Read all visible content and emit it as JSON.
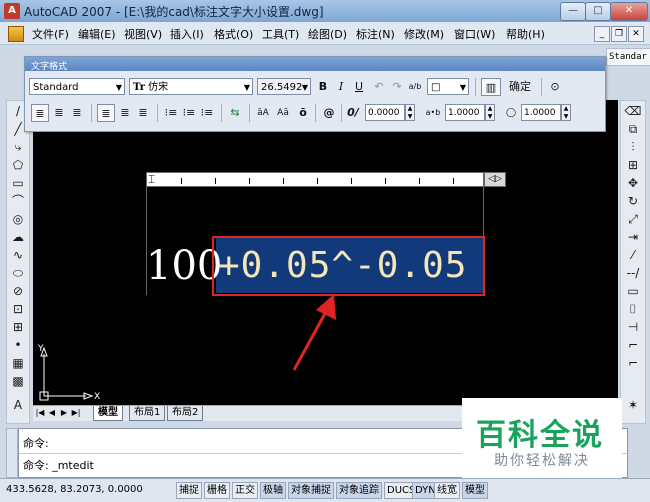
{
  "window": {
    "title": "AutoCAD 2007 - [E:\\我的cad\\标注文字大小设置.dwg]",
    "app_icon_glyph": "A",
    "min_glyph": "—",
    "max_glyph": "□",
    "close_glyph": "✕"
  },
  "menubar": {
    "items": [
      "文件(F)",
      "编辑(E)",
      "视图(V)",
      "插入(I)",
      "格式(O)",
      "工具(T)",
      "绘图(D)",
      "标注(N)",
      "修改(M)",
      "窗口(W)",
      "帮助(H)"
    ],
    "mdi_min": "_",
    "mdi_restore": "❐",
    "mdi_close": "✕"
  },
  "standard_tab": "Standar",
  "text_formatting": {
    "title": "文字格式",
    "style": "Standard",
    "font": "仿宋",
    "font_prefix": "Tr",
    "height": "26.5492",
    "bold": "B",
    "italic": "I",
    "underline": "U",
    "undo": "↶",
    "redo": "↷",
    "stack": "a/b",
    "color_box": "□",
    "ruler_toggle": "▥",
    "ok": "确定",
    "options": "⊙",
    "oblique_label": "0/",
    "oblique_value": "0.0000",
    "tracking_label": "a•b",
    "tracking_value": "1.0000",
    "width_label": "◯",
    "width_value": "1.0000",
    "row2_icons": [
      "≣",
      "≣",
      "≣",
      "≣",
      "≣",
      "≣",
      "⁝≡",
      "⁝≡",
      "⁝≡",
      "⇆",
      "āA",
      "Aā",
      "ō",
      "@"
    ]
  },
  "mtext": {
    "base": "100",
    "stacked": "+0.05^-0.05"
  },
  "ruler": {
    "indent_glyph": "⌶",
    "end_glyph": "◁▷"
  },
  "ucs": {
    "x": "X",
    "y": "Y"
  },
  "layout_tabs": {
    "nav": [
      "|◀",
      "◀",
      "▶",
      "▶|"
    ],
    "tabs": [
      "模型",
      "布局1",
      "布局2"
    ],
    "active": "模型"
  },
  "command": {
    "line1": "命令:",
    "line2": "命令:  _mtedit"
  },
  "status": {
    "coords": "433.5628,  83.2073,  0.0000",
    "buttons": [
      "捕捉",
      "栅格",
      "正交",
      "极轴",
      "对象捕捉",
      "对象追踪",
      "DUCS",
      "DYN",
      "线宽",
      "模型"
    ]
  },
  "left_tools": [
    "/",
    "╱",
    "⤷",
    "⬠",
    "▭",
    "⌒",
    "◎",
    "☁",
    "∿",
    "⬭",
    "⊘",
    "⊡",
    "⊞",
    "•",
    "▦",
    "▩",
    "A"
  ],
  "right_tools": [
    "⌫",
    "⧉",
    "⫶",
    "⊞",
    "✥",
    "↻",
    "⤢",
    "⇥",
    "⁄",
    "--/",
    "▭",
    "⌷",
    "⊣",
    "⌐",
    "⌐",
    "✶"
  ],
  "watermark": {
    "title": "百科全说",
    "subtitle": "助你轻松解决"
  }
}
